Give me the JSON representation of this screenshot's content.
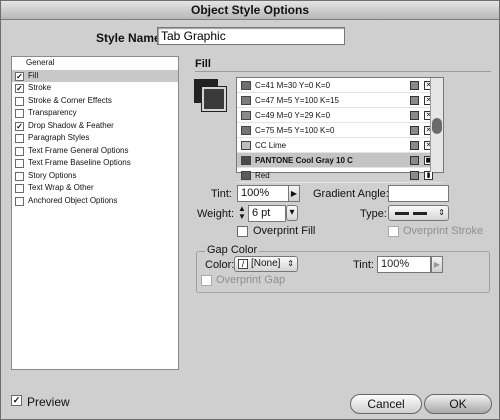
{
  "window": {
    "title": "Object Style Options"
  },
  "style_name": {
    "label": "Style Name:",
    "value": "Tab Graphic"
  },
  "sidebar": {
    "items": [
      {
        "label": "General",
        "checked": null,
        "selected": false
      },
      {
        "label": "Fill",
        "checked": true,
        "selected": true
      },
      {
        "label": "Stroke",
        "checked": true,
        "selected": false
      },
      {
        "label": "Stroke & Corner Effects",
        "checked": false,
        "selected": false
      },
      {
        "label": "Transparency",
        "checked": false,
        "selected": false
      },
      {
        "label": "Drop Shadow & Feather",
        "checked": true,
        "selected": false
      },
      {
        "label": "Paragraph Styles",
        "checked": false,
        "selected": false
      },
      {
        "label": "Text Frame General Options",
        "checked": false,
        "selected": false
      },
      {
        "label": "Text Frame Baseline Options",
        "checked": false,
        "selected": false
      },
      {
        "label": "Story Options",
        "checked": false,
        "selected": false
      },
      {
        "label": "Text Wrap & Other",
        "checked": false,
        "selected": false
      },
      {
        "label": "Anchored Object Options",
        "checked": false,
        "selected": false
      }
    ]
  },
  "fill": {
    "heading": "Fill",
    "swatches": [
      {
        "label": "C=41 M=30 Y=0 K=0",
        "color": "#6f6f6f",
        "selected": false
      },
      {
        "label": "C=47 M=5 Y=100 K=15",
        "color": "#7c7c7c",
        "selected": false
      },
      {
        "label": "C=49 M=0 Y=29 K=0",
        "color": "#8a8a8a",
        "selected": false
      },
      {
        "label": "C=75 M=5 Y=100 K=0",
        "color": "#757575",
        "selected": false
      },
      {
        "label": "CC Lime",
        "color": "#bdbdbd",
        "selected": false
      },
      {
        "label": "PANTONE Cool Gray 10 C",
        "color": "#4a4a4a",
        "selected": true
      },
      {
        "label": "Red",
        "color": "#5a5a5a",
        "selected": false
      }
    ],
    "tint_label": "Tint:",
    "tint_value": "100%",
    "gradient_angle_label": "Gradient Angle:",
    "gradient_angle_value": "",
    "weight_label": "Weight:",
    "weight_value": "6 pt",
    "type_label": "Type:",
    "overprint_fill_label": "Overprint Fill",
    "overprint_stroke_label": "Overprint Stroke"
  },
  "gap": {
    "title": "Gap Color",
    "color_label": "Color:",
    "color_value": "[None]",
    "tint_label": "Tint:",
    "tint_value": "100%",
    "overprint_gap_label": "Overprint Gap"
  },
  "footer": {
    "preview_label": "Preview",
    "preview_checked": true,
    "cancel_label": "Cancel",
    "ok_label": "OK"
  }
}
